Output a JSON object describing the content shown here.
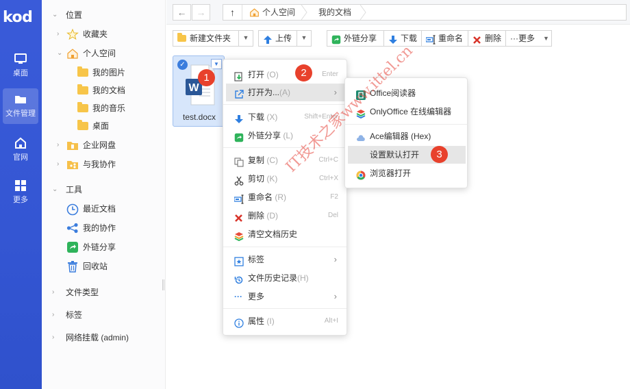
{
  "app": {
    "logo": "kod"
  },
  "rail": [
    {
      "label": "桌面",
      "icon": "desktop-icon"
    },
    {
      "label": "文件管理",
      "icon": "folder-icon"
    },
    {
      "label": "官网",
      "icon": "home-icon"
    },
    {
      "label": "更多",
      "icon": "grid-icon"
    }
  ],
  "tree": {
    "location": "位置",
    "favorites": "收藏夹",
    "personal_space": "个人空间",
    "my_pictures": "我的图片",
    "my_documents": "我的文档",
    "my_music": "我的音乐",
    "desktop": "桌面",
    "enterprise_disk": "企业网盘",
    "shared_with_me": "与我协作",
    "tools": "工具",
    "recent_docs": "最近文档",
    "my_collab": "我的协作",
    "link_share": "外链分享",
    "recycle_bin": "回收站",
    "file_types": "文件类型",
    "tags": "标签",
    "network_mount": "网络挂载 (admin)"
  },
  "address": {
    "back": "←",
    "forward": "→",
    "up": "↑",
    "crumbs": [
      "个人空间",
      "我的文档"
    ]
  },
  "toolbar": {
    "new_folder": "新建文件夹",
    "upload": "上传",
    "share": "外链分享",
    "download": "下载",
    "rename": "重命名",
    "delete": "删除",
    "more": "更多"
  },
  "file": {
    "name": "test.docx"
  },
  "badges": [
    "1",
    "2",
    "3"
  ],
  "context_menu": [
    {
      "label": "打开",
      "key": "(O)",
      "shortcut": "Enter"
    },
    {
      "label": "打开为...",
      "key": "(A)"
    },
    {
      "label": "下载",
      "key": "(X)",
      "shortcut": "Shift+Enter"
    },
    {
      "label": "外链分享",
      "key": "(L)"
    },
    {
      "label": "复制",
      "key": "(C)",
      "shortcut": "Ctrl+C"
    },
    {
      "label": "剪切",
      "key": "(K)",
      "shortcut": "Ctrl+X"
    },
    {
      "label": "重命名",
      "key": "(R)",
      "shortcut": "F2"
    },
    {
      "label": "删除",
      "key": "(D)",
      "shortcut": "Del"
    },
    {
      "label": "清空文档历史",
      "key": ""
    },
    {
      "label": "标签",
      "key": ""
    },
    {
      "label": "文件历史记录",
      "key": "(H)"
    },
    {
      "label": "更多",
      "key": ""
    },
    {
      "label": "属性",
      "key": "(I)",
      "shortcut": "Alt+I"
    }
  ],
  "open_as_menu": [
    {
      "label": "Office阅读器"
    },
    {
      "label": "OnlyOffice 在线编辑器"
    },
    {
      "label": "Ace编辑器 (Hex)"
    },
    {
      "label": "设置默认打开"
    },
    {
      "label": "浏览器打开"
    }
  ],
  "watermark": "IT技术之家www.ittel.cn",
  "colors": {
    "rail": "#3456d3",
    "badge": "#e8412c",
    "accent": "#3b7ddd",
    "folder": "#f7c549"
  }
}
